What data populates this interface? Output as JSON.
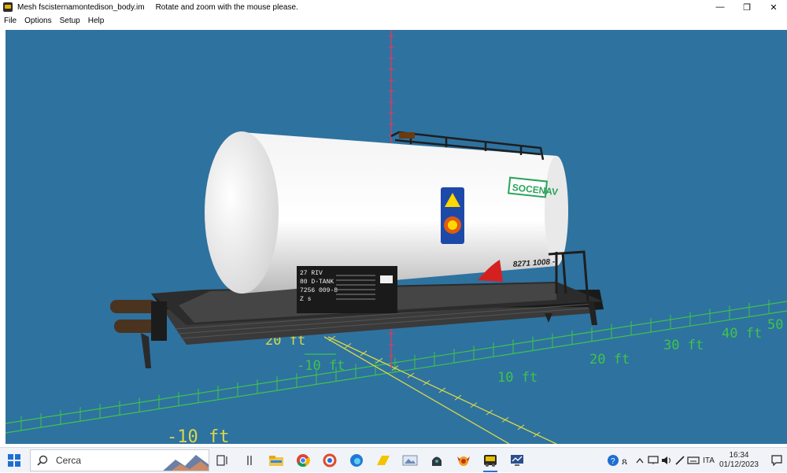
{
  "window": {
    "title": "Mesh fscisternamontedison_body.im",
    "hint": "Rotate and zoom with the mouse please.",
    "controls": {
      "minimize": "—",
      "restore": "❐",
      "close": "✕"
    }
  },
  "menu": [
    "File",
    "Options",
    "Setup",
    "Help"
  ],
  "viewport": {
    "background": "#2e72a0",
    "axis_labels": {
      "x_pos_10": "10 ft",
      "x_pos_20": "20 ft",
      "x_pos_30": "30 ft",
      "x_pos_40": "40 ft",
      "x_pos_50": "50",
      "x_neg_10": "-10 ft",
      "z_neg_10": "-10 ft",
      "z_neg_20": "20 ft"
    },
    "tank_car": {
      "logo_text": "SOCENAV",
      "car_number": "8271 1008 -",
      "plate_lines": [
        "27 RIV",
        "80 D-TANK",
        "7256 009-8",
        "Z s"
      ]
    }
  },
  "taskbar": {
    "search_placeholder": "Cerca",
    "apps": [
      "task-view",
      "widgets",
      "file-explorer",
      "chrome",
      "app-red",
      "edge",
      "app-yellow",
      "app-viewer",
      "app-dark",
      "app-game",
      "train-mesh-app",
      "app-monitor"
    ],
    "language": "ITA",
    "time": "16:34",
    "date": "01/12/2023"
  }
}
